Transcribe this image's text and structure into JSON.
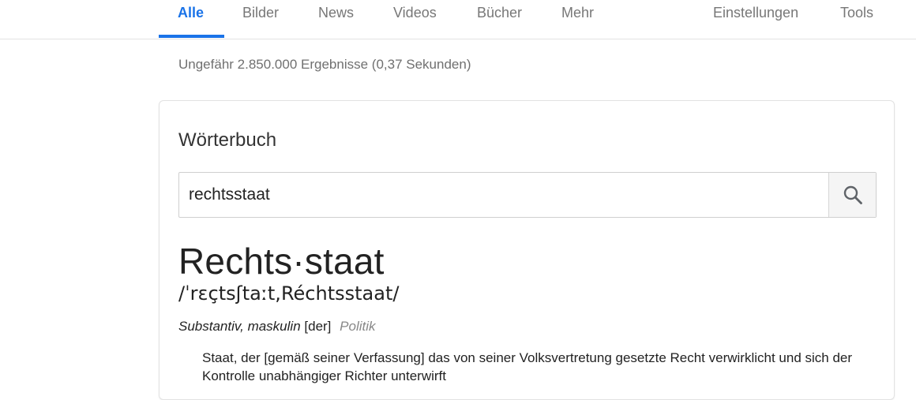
{
  "nav": {
    "tabs": [
      {
        "label": "Alle",
        "active": true
      },
      {
        "label": "Bilder"
      },
      {
        "label": "News"
      },
      {
        "label": "Videos"
      },
      {
        "label": "Bücher"
      },
      {
        "label": "Mehr"
      }
    ],
    "right": [
      {
        "label": "Einstellungen"
      },
      {
        "label": "Tools"
      }
    ]
  },
  "results_stats": "Ungefähr 2.850.000 Ergebnisse (0,37 Sekunden)",
  "dictionary": {
    "title": "Wörterbuch",
    "search_value": "rechtsstaat",
    "search_icon": "search-icon",
    "headword": "Rechts·staat",
    "pronunciation": "/ˈrɛçtsʃtaːt,Réchtsstaat/",
    "part_of_speech": "Substantiv, maskulin",
    "gender": "[der]",
    "domain": "Politik",
    "definition": "Staat, der [gemäß seiner Verfassung] das von seiner Volksvertretung gesetzte Recht verwirklicht und sich der Kontrolle unabhängiger Richter unterwirft"
  },
  "colors": {
    "accent": "#1a73e8",
    "muted": "#777777"
  }
}
